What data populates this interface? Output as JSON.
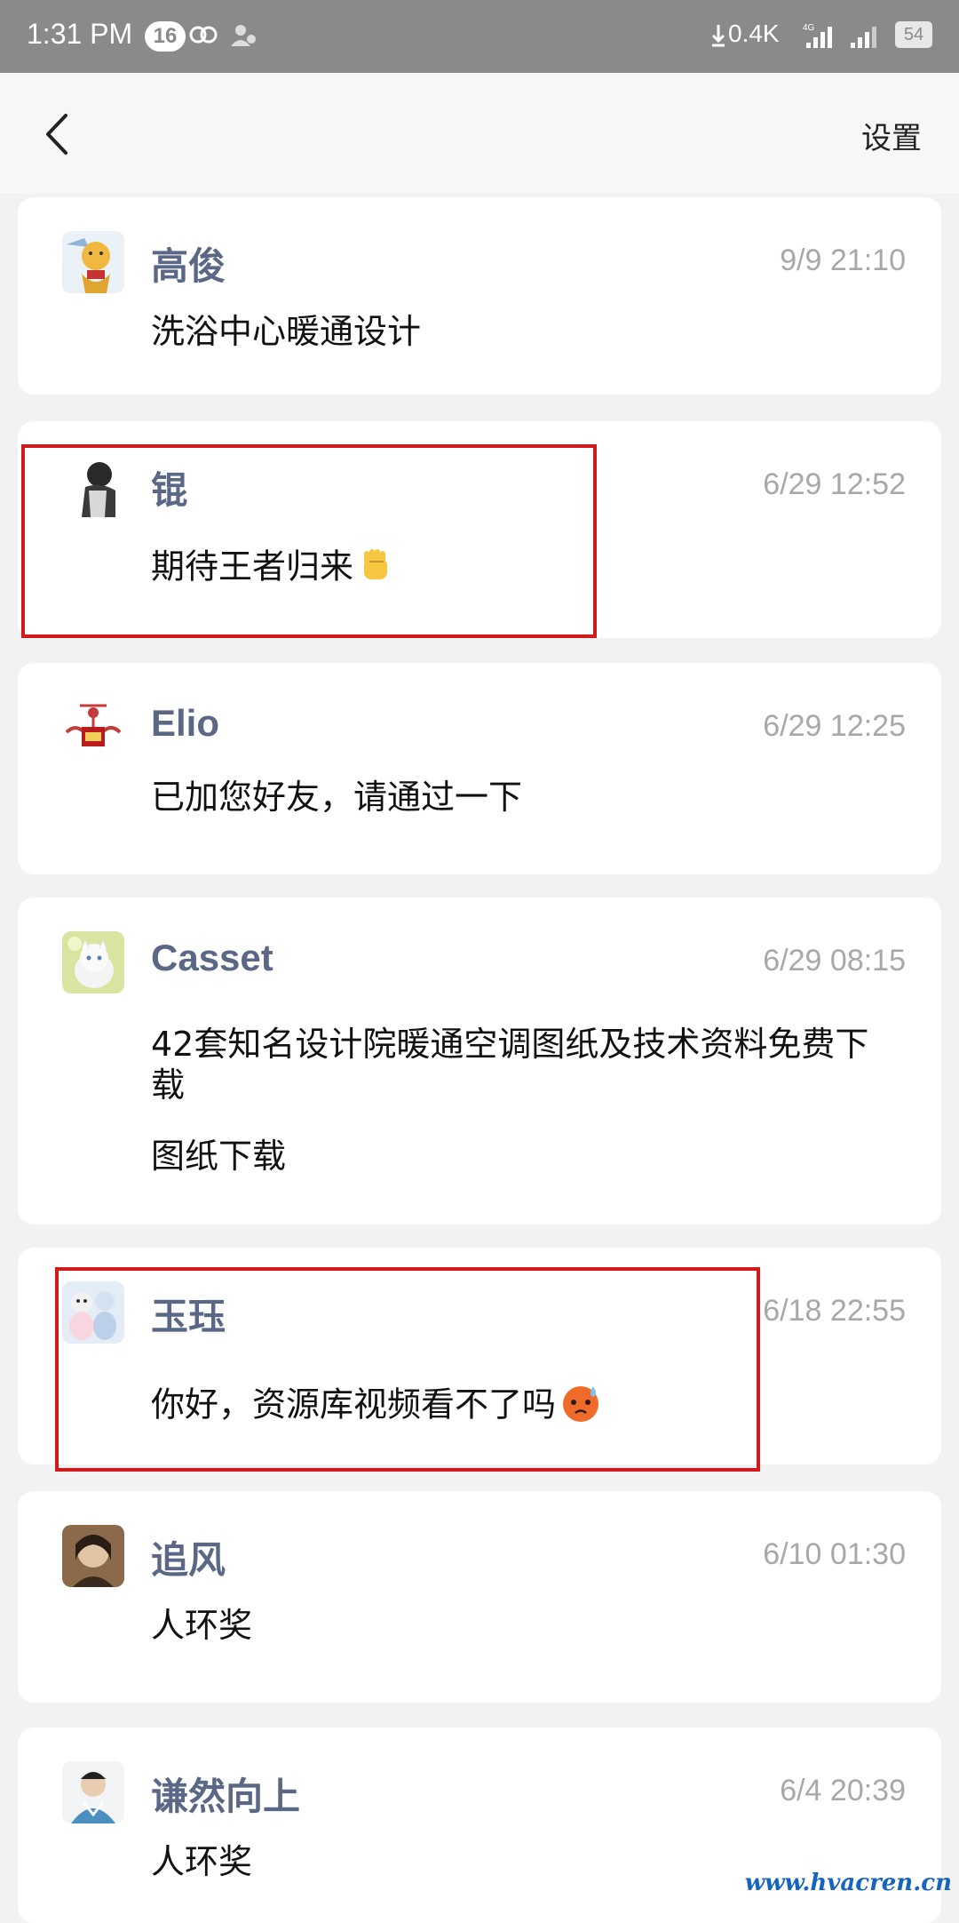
{
  "status_bar": {
    "time": "1:31 PM",
    "notification_count": "16",
    "net_speed": "0.4K",
    "network": "4G",
    "battery": "54"
  },
  "header": {
    "back_icon": "chevron-left-icon",
    "settings_label": "设置"
  },
  "messages": [
    {
      "name": "高俊",
      "time": "9/9 21:10",
      "text": "洗浴中心暖通设计"
    },
    {
      "name": "锟",
      "time": "6/29 12:52",
      "text": "期待王者归来",
      "emoji": "raised-fist-emoji"
    },
    {
      "name": "Elio",
      "time": "6/29 12:25",
      "text": "已加您好友，请通过一下"
    },
    {
      "name": "Casset",
      "time": "6/29 08:15",
      "text": "42套知名设计院暖通空调图纸及技术资料免费下载",
      "link_text": "图纸下载"
    },
    {
      "name": "玉珏",
      "time": "6/18 22:55",
      "text": "你好，资源库视频看不了吗",
      "emoji": "sweat-face-emoji"
    },
    {
      "name": "追风",
      "time": "6/10 01:30",
      "text": "人环奖"
    },
    {
      "name": "谦然向上",
      "time": "6/4 20:39",
      "text": "人环奖"
    }
  ],
  "colors": {
    "name": "#5a6886",
    "timestamp": "#a8a8a8",
    "highlight": "#d11a1a",
    "background": "#f2f2f2"
  },
  "watermark": "www.hvacren.cn"
}
